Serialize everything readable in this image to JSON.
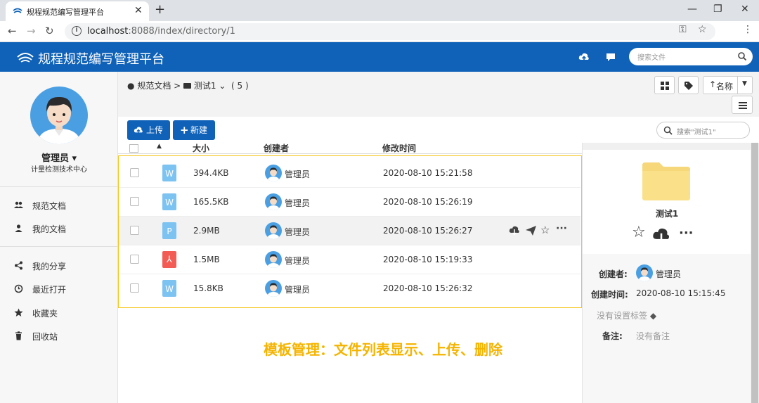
{
  "browser": {
    "tab_title": "规程规范编写管理平台",
    "url_host": "localhost",
    "url_rest": ":8088/index/directory/1"
  },
  "app": {
    "title": "规程规范编写管理平台",
    "search_placeholder": "搜索文件"
  },
  "sidebar": {
    "user_name": "管理员",
    "user_dept": "计量检测技术中心",
    "items": [
      {
        "label": "规范文档",
        "icon": "users-icon"
      },
      {
        "label": "我的文档",
        "icon": "user-icon"
      },
      {
        "label": "我的分享",
        "icon": "share-icon"
      },
      {
        "label": "最近打开",
        "icon": "clock-icon"
      },
      {
        "label": "收藏夹",
        "icon": "star-icon"
      },
      {
        "label": "回收站",
        "icon": "trash-icon"
      }
    ]
  },
  "breadcrumb": {
    "root": "规范文档",
    "sep": ">",
    "folder": "测试1",
    "count": "( 5 )"
  },
  "toolbar": {
    "sort_label": "名称",
    "upload_label": "上传",
    "new_label": "新建",
    "search_placeholder": "搜索\"测试1\""
  },
  "table": {
    "headers": {
      "size": "大小",
      "creator": "创建者",
      "mtime": "修改时间"
    },
    "rows": [
      {
        "type": "W",
        "color": "#7cc3f2",
        "size": "394.4KB",
        "creator": "管理员",
        "mtime": "2020-08-10 15:21:58"
      },
      {
        "type": "W",
        "color": "#7cc3f2",
        "size": "165.5KB",
        "creator": "管理员",
        "mtime": "2020-08-10 15:26:19"
      },
      {
        "type": "P",
        "color": "#7cc3f2",
        "size": "2.9MB",
        "creator": "管理员",
        "mtime": "2020-08-10 15:26:27"
      },
      {
        "type": "pdf",
        "color": "#f25c54",
        "size": "1.5MB",
        "creator": "管理员",
        "mtime": "2020-08-10 15:19:33"
      },
      {
        "type": "W",
        "color": "#7cc3f2",
        "size": "15.8KB",
        "creator": "管理员",
        "mtime": "2020-08-10 15:26:32"
      }
    ]
  },
  "caption": "模板管理：文件列表显示、上传、删除",
  "detail": {
    "name": "测试1",
    "creator_label": "创建者:",
    "creator": "管理员",
    "ctime_label": "创建时间:",
    "ctime": "2020-08-10 15:15:45",
    "tags": "没有设置标签",
    "note_label": "备注:",
    "note": "没有备注"
  }
}
